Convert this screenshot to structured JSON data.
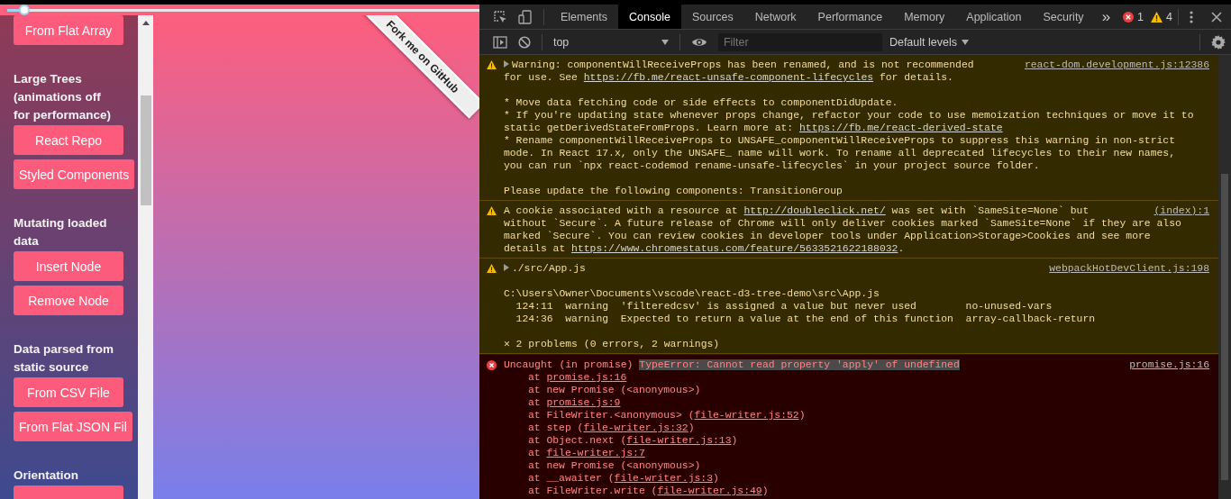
{
  "page": {
    "slider": {
      "level": 0.04
    },
    "sidebar": {
      "items": [
        {
          "kind": "button",
          "label": "From Flat Array"
        },
        {
          "kind": "heading",
          "label": "Large Trees (animations off for performance)"
        },
        {
          "kind": "button",
          "label": "React Repo"
        },
        {
          "kind": "button",
          "label": "Styled Components"
        },
        {
          "kind": "heading",
          "label": "Mutating loaded data"
        },
        {
          "kind": "button",
          "label": "Insert Node"
        },
        {
          "kind": "button",
          "label": "Remove Node"
        },
        {
          "kind": "heading",
          "label": "Data parsed from static source"
        },
        {
          "kind": "button",
          "label": "From CSV File"
        },
        {
          "kind": "button",
          "label": "From Flat JSON Fil"
        },
        {
          "kind": "heading",
          "label": "Orientation"
        },
        {
          "kind": "button"
        }
      ]
    },
    "ribbon": {
      "label": "Fork me on GitHub"
    }
  },
  "devtools": {
    "tabs": [
      {
        "label": "Elements",
        "selected": false
      },
      {
        "label": "Console",
        "selected": true
      },
      {
        "label": "Sources",
        "selected": false
      },
      {
        "label": "Network",
        "selected": false
      },
      {
        "label": "Performance",
        "selected": false
      },
      {
        "label": "Memory",
        "selected": false
      },
      {
        "label": "Application",
        "selected": false
      },
      {
        "label": "Security",
        "selected": false
      }
    ],
    "more": "»",
    "error_count": "1",
    "warning_count": "4",
    "context": "top",
    "filter": {
      "placeholder": "Filter"
    },
    "levels": "Default levels",
    "messages": [
      {
        "kind": "warning",
        "has_toggle": true,
        "source": "react-dom.development.js:12386",
        "lines": [
          {
            "gap": false,
            "parts": [
              {
                "kind": "text",
                "text": "Warning: componentWillReceiveProps has been renamed, and is not recommended"
              }
            ]
          },
          {
            "gap": false,
            "parts": [
              {
                "kind": "text",
                "text": "for use. See "
              },
              {
                "kind": "link",
                "text": "https://fb.me/react-unsafe-component-lifecycles"
              },
              {
                "kind": "text",
                "text": " for details."
              }
            ]
          },
          {
            "gap": true,
            "parts": [
              {
                "kind": "text",
                "text": "* Move data fetching code or side effects to componentDidUpdate."
              }
            ]
          },
          {
            "gap": false,
            "parts": [
              {
                "kind": "text",
                "text": "* If you're updating state whenever props change, refactor your code to use memoization techniques or move it to"
              }
            ]
          },
          {
            "gap": false,
            "parts": [
              {
                "kind": "text",
                "text": "static getDerivedStateFromProps. Learn more at: "
              },
              {
                "kind": "link",
                "text": "https://fb.me/react-derived-state"
              }
            ]
          },
          {
            "gap": false,
            "parts": [
              {
                "kind": "text",
                "text": "* Rename componentWillReceiveProps to UNSAFE_componentWillReceiveProps to suppress this warning in non-strict"
              }
            ]
          },
          {
            "gap": false,
            "parts": [
              {
                "kind": "text",
                "text": "mode. In React 17.x, only the UNSAFE_ name will work. To rename all deprecated lifecycles to their new names,"
              }
            ]
          },
          {
            "gap": false,
            "parts": [
              {
                "kind": "text",
                "text": "you can run `npx react-codemod rename-unsafe-lifecycles` in your project source folder."
              }
            ]
          },
          {
            "gap": true,
            "parts": [
              {
                "kind": "text",
                "text": "Please update the following components: TransitionGroup"
              }
            ]
          }
        ]
      },
      {
        "kind": "warning",
        "has_toggle": false,
        "source": "(index):1",
        "lines": [
          {
            "gap": false,
            "parts": [
              {
                "kind": "text",
                "text": "A cookie associated with a resource at "
              },
              {
                "kind": "link",
                "text": "http://doubleclick.net/"
              },
              {
                "kind": "text",
                "text": " was set with `SameSite=None` but"
              }
            ]
          },
          {
            "gap": false,
            "parts": [
              {
                "kind": "text",
                "text": "without `Secure`. A future release of Chrome will only deliver cookies marked `SameSite=None` if they are also"
              }
            ]
          },
          {
            "gap": false,
            "parts": [
              {
                "kind": "text",
                "text": "marked `Secure`. You can review cookies in developer tools under Application>Storage>Cookies and see more"
              }
            ]
          },
          {
            "gap": false,
            "parts": [
              {
                "kind": "text",
                "text": "details at "
              },
              {
                "kind": "link",
                "text": "https://www.chromestatus.com/feature/5633521622188032"
              },
              {
                "kind": "text",
                "text": "."
              }
            ]
          }
        ]
      },
      {
        "kind": "warning",
        "has_toggle": true,
        "source": "webpackHotDevClient.js:198",
        "lines": [
          {
            "gap": false,
            "parts": [
              {
                "kind": "text",
                "text": "./src/App.js"
              }
            ]
          },
          {
            "gap": true,
            "parts": [
              {
                "kind": "text",
                "text": "C:\\Users\\Owner\\Documents\\vscode\\react-d3-tree-demo\\src\\App.js"
              }
            ]
          },
          {
            "gap": false,
            "parts": [
              {
                "kind": "text",
                "text": "  124:11  warning  'filteredcsv' is assigned a value but never used        no-unused-vars"
              }
            ]
          },
          {
            "gap": false,
            "parts": [
              {
                "kind": "text",
                "text": "  124:36  warning  Expected to return a value at the end of this function  array-callback-return"
              }
            ]
          },
          {
            "gap": true,
            "parts": [
              {
                "kind": "text",
                "text": "✕ 2 problems (0 errors, 2 warnings)"
              }
            ]
          }
        ]
      },
      {
        "kind": "error",
        "has_toggle": false,
        "source": "promise.js:16",
        "lines": [
          {
            "gap": false,
            "parts": [
              {
                "kind": "text",
                "text": "Uncaught (in promise) "
              },
              {
                "kind": "highlight",
                "text": "TypeError: Cannot read property 'apply' of undefined"
              }
            ]
          },
          {
            "gap": false,
            "indent": true,
            "parts": [
              {
                "kind": "text",
                "text": "at "
              },
              {
                "kind": "link",
                "text": "promise.js:16"
              }
            ]
          },
          {
            "gap": false,
            "indent": true,
            "parts": [
              {
                "kind": "text",
                "text": "at new Promise (<anonymous>)"
              }
            ]
          },
          {
            "gap": false,
            "indent": true,
            "parts": [
              {
                "kind": "text",
                "text": "at "
              },
              {
                "kind": "link",
                "text": "promise.js:9"
              }
            ]
          },
          {
            "gap": false,
            "indent": true,
            "parts": [
              {
                "kind": "text",
                "text": "at FileWriter.<anonymous> ("
              },
              {
                "kind": "link",
                "text": "file-writer.js:52"
              },
              {
                "kind": "text",
                "text": ")"
              }
            ]
          },
          {
            "gap": false,
            "indent": true,
            "parts": [
              {
                "kind": "text",
                "text": "at step ("
              },
              {
                "kind": "link",
                "text": "file-writer.js:32"
              },
              {
                "kind": "text",
                "text": ")"
              }
            ]
          },
          {
            "gap": false,
            "indent": true,
            "parts": [
              {
                "kind": "text",
                "text": "at Object.next ("
              },
              {
                "kind": "link",
                "text": "file-writer.js:13"
              },
              {
                "kind": "text",
                "text": ")"
              }
            ]
          },
          {
            "gap": false,
            "indent": true,
            "parts": [
              {
                "kind": "text",
                "text": "at "
              },
              {
                "kind": "link",
                "text": "file-writer.js:7"
              }
            ]
          },
          {
            "gap": false,
            "indent": true,
            "parts": [
              {
                "kind": "text",
                "text": "at new Promise (<anonymous>)"
              }
            ]
          },
          {
            "gap": false,
            "indent": true,
            "parts": [
              {
                "kind": "text",
                "text": "at __awaiter ("
              },
              {
                "kind": "link",
                "text": "file-writer.js:3"
              },
              {
                "kind": "text",
                "text": ")"
              }
            ]
          },
          {
            "gap": false,
            "indent": true,
            "parts": [
              {
                "kind": "text",
                "text": "at FileWriter.write ("
              },
              {
                "kind": "link",
                "text": "file-writer.js:49"
              },
              {
                "kind": "text",
                "text": ")"
              }
            ]
          }
        ]
      }
    ]
  }
}
